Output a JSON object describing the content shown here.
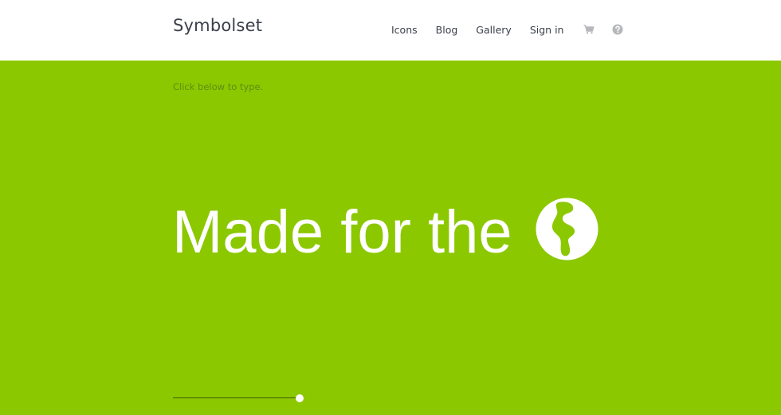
{
  "header": {
    "logo": "Symbolset",
    "nav": [
      {
        "label": "Icons"
      },
      {
        "label": "Blog"
      },
      {
        "label": "Gallery"
      },
      {
        "label": "Sign in"
      }
    ],
    "icons": [
      "cart-icon",
      "help-icon"
    ]
  },
  "hero": {
    "hint": "Click below to type.",
    "headline": "Made for the",
    "headline_icon": "globe-icon",
    "slider_value": 0.96
  },
  "colors": {
    "brand_green": "#8bc800",
    "header_bg": "#ffffff",
    "nav_text": "#3a3f4a",
    "nav_icon": "#b5b7bb",
    "hint_text": "#5f8d10",
    "headline": "#ffffff"
  }
}
